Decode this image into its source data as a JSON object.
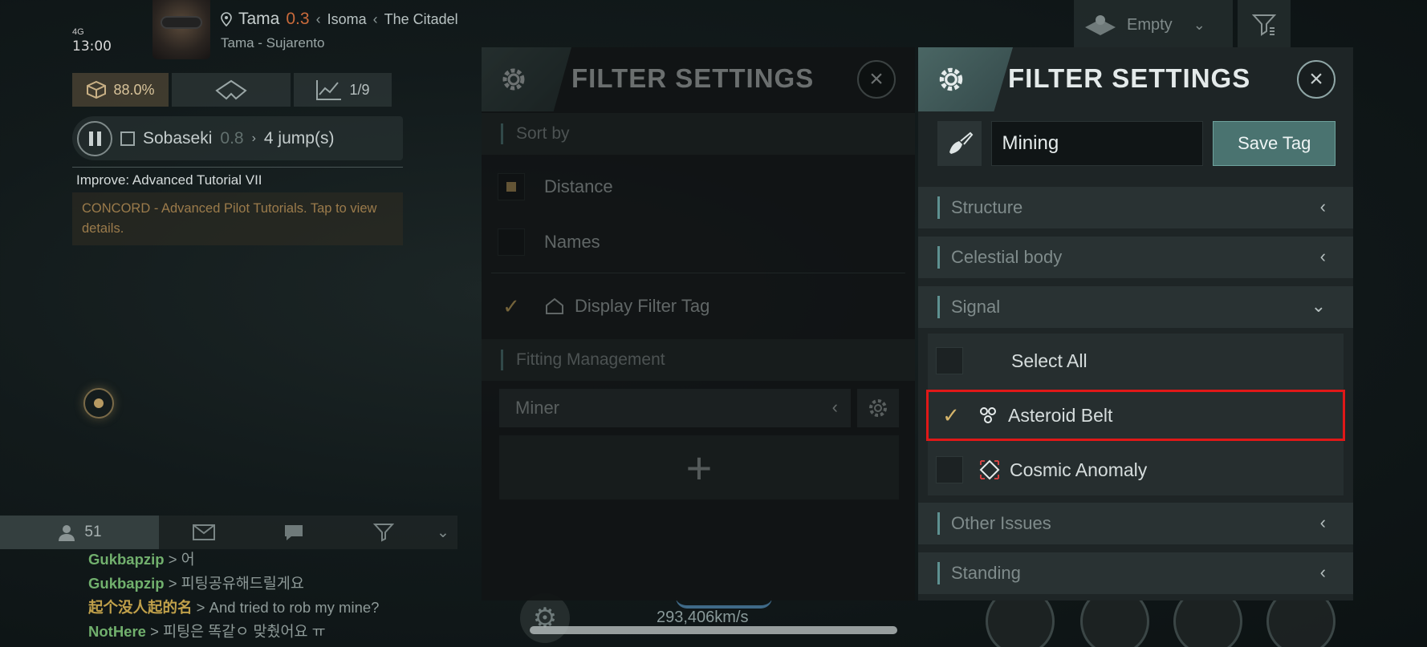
{
  "hud": {
    "signal": "4G",
    "time": "13:00",
    "location": {
      "system": "Tama",
      "security": "0.3",
      "constellation": "Isoma",
      "region": "The Citadel",
      "sub": "Tama - Sujarento"
    },
    "cargo_percent": "88.0%",
    "stats": "1/9",
    "route": {
      "destination": "Sobaseki",
      "security": "0.8",
      "jumps": "4 jump(s)"
    },
    "mission": {
      "title": "Improve: Advanced Tutorial VII",
      "description": "CONCORD - Advanced Pilot Tutorials. Tap to view details."
    },
    "empty_label": "Empty",
    "speed": "293,406km/s"
  },
  "chat": {
    "member_count": "51",
    "lines": [
      {
        "who": "Gukbapzip",
        "msg": "어"
      },
      {
        "who": "Gukbapzip",
        "msg": "피팅공유해드릴게요"
      },
      {
        "who": "起个没人起的名",
        "msg": "And tried to rob my mine?"
      },
      {
        "who": "NotHere",
        "msg": "피팅은 똑같ㅇ 맞췄어요 ㅠ"
      }
    ]
  },
  "background_panel": {
    "title": "FILTER SETTINGS",
    "sort_by_label": "Sort by",
    "options": [
      {
        "label": "Distance",
        "state": "selected"
      },
      {
        "label": "Names",
        "state": "unchecked"
      }
    ],
    "display_filter_tag": "Display Filter Tag",
    "fitting_management": "Fitting Management",
    "fitting_value": "Miner"
  },
  "filter_panel": {
    "title": "FILTER SETTINGS",
    "tag_value": "Mining",
    "save_tag_label": "Save Tag",
    "categories": [
      {
        "label": "Structure",
        "expanded": false
      },
      {
        "label": "Celestial body",
        "expanded": false
      },
      {
        "label": "Signal",
        "expanded": true
      },
      {
        "label": "Other Issues",
        "expanded": false
      },
      {
        "label": "Standing",
        "expanded": false
      }
    ],
    "signal_items": [
      {
        "label": "Select All",
        "checked": false
      },
      {
        "label": "Asteroid Belt",
        "checked": true,
        "icon": "asteroid-icon"
      },
      {
        "label": "Cosmic Anomaly",
        "checked": false,
        "icon": "anomaly-icon"
      }
    ]
  },
  "colors": {
    "accent": "#4a7370",
    "check": "#d4b46b",
    "highlight": "#e01818",
    "security_low": "#c96a3b"
  }
}
